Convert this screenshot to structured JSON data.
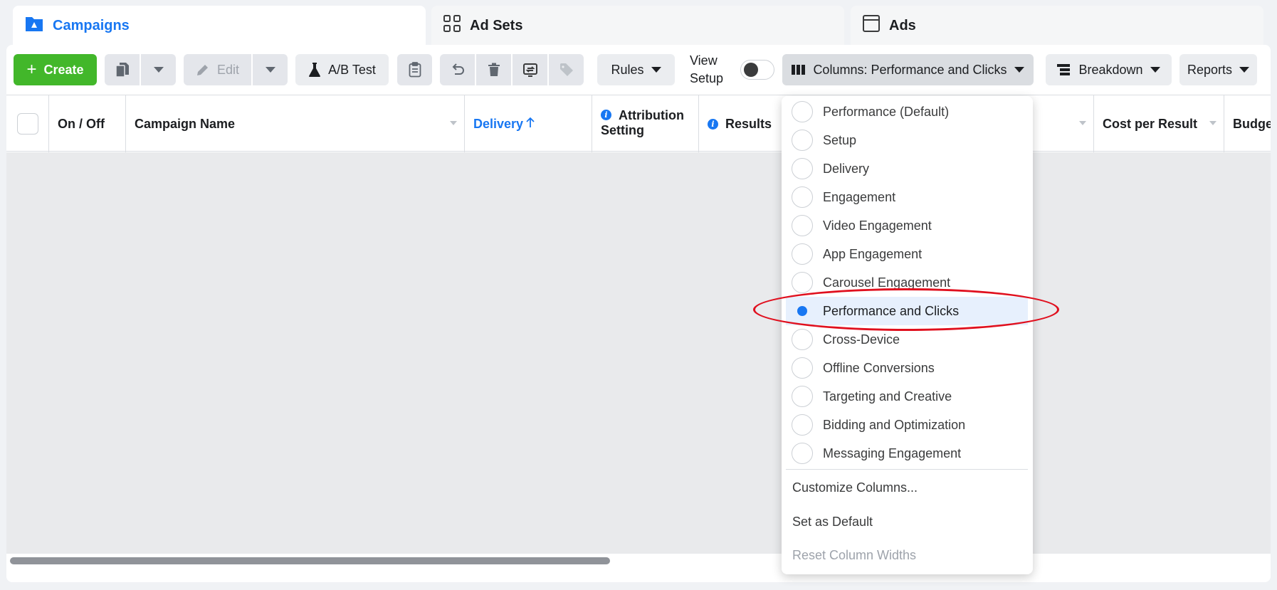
{
  "tabs": [
    {
      "label": "Campaigns",
      "icon": "campaign-folder-icon",
      "active": true
    },
    {
      "label": "Ad Sets",
      "icon": "grid-icon",
      "active": false
    },
    {
      "label": "Ads",
      "icon": "ad-window-icon",
      "active": false
    }
  ],
  "toolbar": {
    "create_label": "Create",
    "edit_label": "Edit",
    "ab_test_label": "A/B Test",
    "rules_label": "Rules",
    "view_setup_line1": "View",
    "view_setup_line2": "Setup",
    "columns_label": "Columns: Performance and Clicks",
    "breakdown_label": "Breakdown",
    "reports_label": "Reports"
  },
  "table": {
    "headers": {
      "on_off": "On / Off",
      "campaign_name": "Campaign Name",
      "delivery": "Delivery",
      "attribution_line1": "Attribution",
      "attribution_line2": "Setting",
      "results": "Results",
      "cost_per_result": "Cost per Result",
      "budget": "Budget"
    }
  },
  "columns_menu": {
    "options": [
      "Performance (Default)",
      "Setup",
      "Delivery",
      "Engagement",
      "Video Engagement",
      "App Engagement",
      "Carousel Engagement",
      "Performance and Clicks",
      "Cross-Device",
      "Offline Conversions",
      "Targeting and Creative",
      "Bidding and Optimization",
      "Messaging Engagement"
    ],
    "selected": "Performance and Clicks",
    "actions": {
      "customize": "Customize Columns...",
      "set_default": "Set as Default",
      "reset_widths": "Reset Column Widths"
    }
  },
  "colors": {
    "accent": "#1877f2",
    "create_green": "#42b72a",
    "annotation_red": "#e0101e"
  }
}
